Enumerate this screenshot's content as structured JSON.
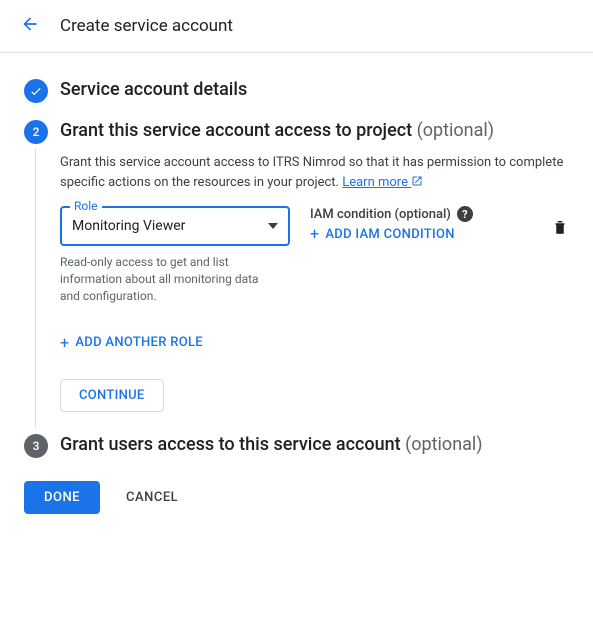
{
  "header": {
    "title": "Create service account"
  },
  "step1": {
    "title": "Service account details"
  },
  "step2": {
    "title": "Grant this service account access to project",
    "optional": "(optional)",
    "desc_prefix": "Grant this service account access to ITRS Nimrod so that it has permission to complete specific actions on the resources in your project. ",
    "learn_more": "Learn more",
    "role_label": "Role",
    "role_value": "Monitoring Viewer",
    "role_helper": "Read-only access to get and list information about all monitoring data and configuration.",
    "iam_label": "IAM condition (optional)",
    "add_iam": "ADD IAM CONDITION",
    "add_another": "ADD ANOTHER ROLE",
    "continue": "CONTINUE"
  },
  "step3": {
    "title": "Grant users access to this service account",
    "optional": "(optional)"
  },
  "footer": {
    "done": "DONE",
    "cancel": "CANCEL"
  }
}
